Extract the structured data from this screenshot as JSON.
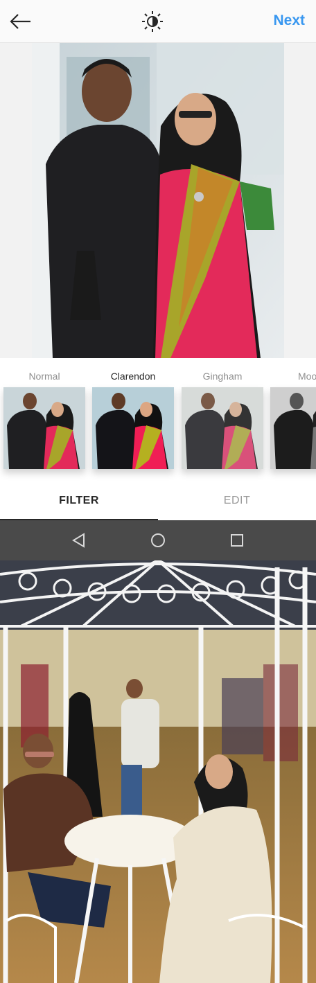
{
  "header": {
    "next_label": "Next",
    "back_icon": "arrow-left-icon",
    "brightness_icon": "brightness-icon"
  },
  "filters": [
    {
      "label": "Normal"
    },
    {
      "label": "Clarendon"
    },
    {
      "label": "Gingham"
    },
    {
      "label": "Moon"
    }
  ],
  "tabs": {
    "filter_label": "FILTER",
    "edit_label": "EDIT"
  },
  "navbar": {
    "back_icon": "nav-back-icon",
    "home_icon": "nav-home-icon",
    "recents_icon": "nav-recents-icon"
  },
  "colors": {
    "accent": "#3897f0",
    "navbar": "#4a4a4a"
  }
}
